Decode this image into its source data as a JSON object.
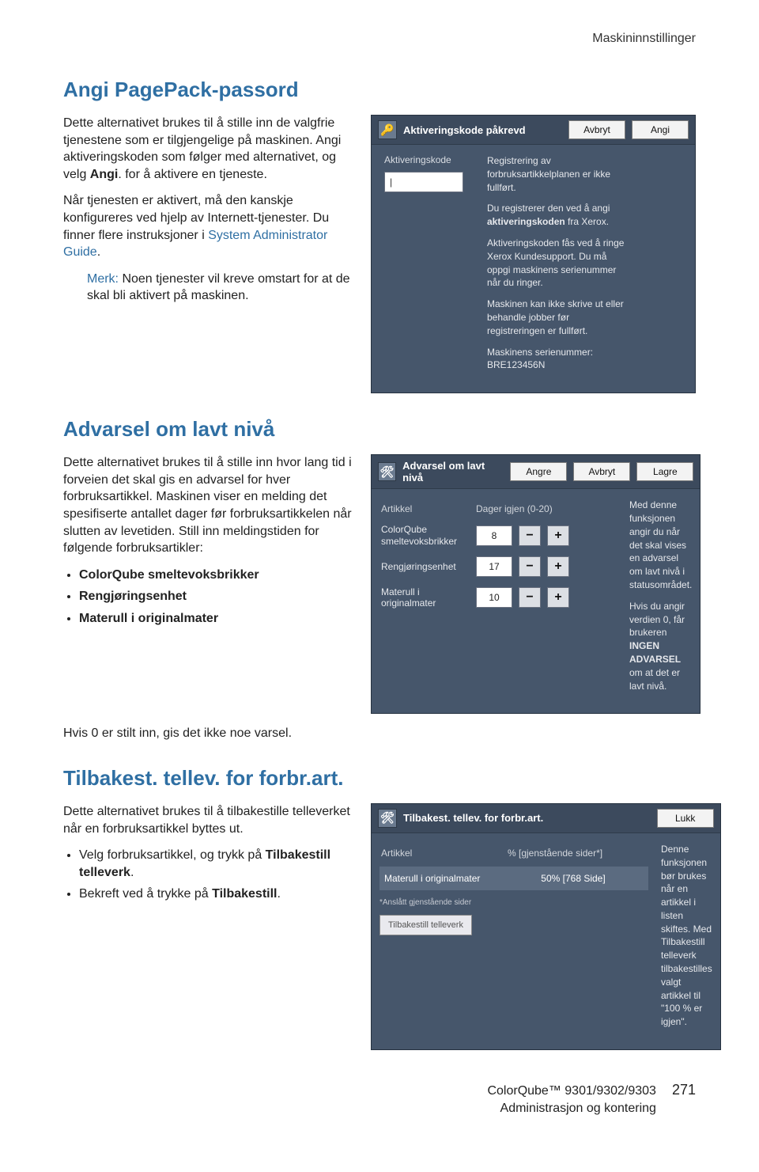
{
  "running_head": "Maskininnstillinger",
  "section1": {
    "heading": "Angi PagePack-passord",
    "p1a": "Dette alternativet brukes til å stille inn de valgfrie tjenestene som er tilgjengelige på maskinen. Angi aktiveringskoden som følger med alternativet, og velg ",
    "p1b": "Angi",
    "p1c": ". for å aktivere en tjeneste.",
    "p2a": "Når tjenesten er aktivert, må den kanskje konfigureres ved hjelp av Internett-tjenester. Du finner flere instruksjoner i ",
    "p2b": "System Administrator Guide",
    "p2c": ".",
    "note_label": "Merk:",
    "note_text": " Noen tjenester vil kreve omstart for at de skal bli aktivert på maskinen."
  },
  "panel1": {
    "title": "Aktiveringskode påkrevd",
    "btn_cancel": "Avbryt",
    "btn_submit": "Angi",
    "field_label": "Aktiveringskode",
    "field_value": "|",
    "info_p1": "Registrering av forbruksartikkelplanen er ikke fullført.",
    "info_p2_a": "Du registrerer den ved å angi ",
    "info_p2_b": "aktiveringskoden",
    "info_p2_c": " fra Xerox.",
    "info_p3": "Aktiveringskoden fås ved å ringe Xerox Kundesupport. Du må oppgi maskinens serienummer når du ringer.",
    "info_p4": "Maskinen kan ikke skrive ut eller behandle jobber før registreringen er fullført.",
    "info_p5": "Maskinens serienummer: BRE123456N"
  },
  "section2": {
    "heading": "Advarsel om lavt nivå",
    "p1": "Dette alternativet brukes til å stille inn hvor lang tid i forveien det skal gis en advarsel for hver forbruksartikkel. Maskinen viser en melding det spesifiserte antallet dager før forbruksartikkelen når slutten av levetiden. Still inn meldingstiden for følgende forbruksartikler:",
    "li1": "ColorQube smeltevoksbrikker",
    "li2": "Rengjøringsenhet",
    "li3": "Materull i originalmater",
    "after": "Hvis 0 er stilt inn, gis det ikke noe varsel."
  },
  "panel2": {
    "title": "Advarsel om lavt nivå",
    "btn_undo": "Angre",
    "btn_cancel": "Avbryt",
    "btn_save": "Lagre",
    "col_article": "Artikkel",
    "col_days": "Dager igjen (0-20)",
    "rows": [
      {
        "name": "ColorQube smeltevoksbrikker",
        "value": "8"
      },
      {
        "name": "Rengjøringsenhet",
        "value": "17"
      },
      {
        "name": "Materull i originalmater",
        "value": "10"
      }
    ],
    "info_p1": "Med denne funksjonen angir du når det skal vises en advarsel om lavt nivå i statusområdet.",
    "info_p2_a": "Hvis du angir verdien 0, får brukeren ",
    "info_p2_b": "INGEN ADVARSEL",
    "info_p2_c": " om at det er lavt nivå."
  },
  "section3": {
    "heading": "Tilbakest. tellev. for forbr.art.",
    "p1": "Dette alternativet brukes til å tilbakestille telleverket når en forbruksartikkel byttes ut.",
    "li1_a": "Velg forbruksartikkel, og trykk på ",
    "li1_b": "Tilbakestill telleverk",
    "li1_c": ".",
    "li2_a": "Bekreft ved å trykke på ",
    "li2_b": "Tilbakestill",
    "li2_c": "."
  },
  "panel3": {
    "title": "Tilbakest. tellev. for forbr.art.",
    "btn_close": "Lukk",
    "col_article": "Artikkel",
    "col_pct": "% [gjenstående sider*]",
    "row_name": "Materull i originalmater",
    "row_value": "50% [768 Side]",
    "note": "*Anslått gjenstående sider",
    "action_btn": "Tilbakestill telleverk",
    "info": "Denne funksjonen bør brukes når en artikkel i listen skiftes. Med Tilbakestill telleverk tilbakestilles valgt artikkel til \"100 % er igjen\"."
  },
  "footer": {
    "product": "ColorQube™ 9301/9302/9303",
    "doc": "Administrasjon og kontering",
    "page": "271"
  }
}
